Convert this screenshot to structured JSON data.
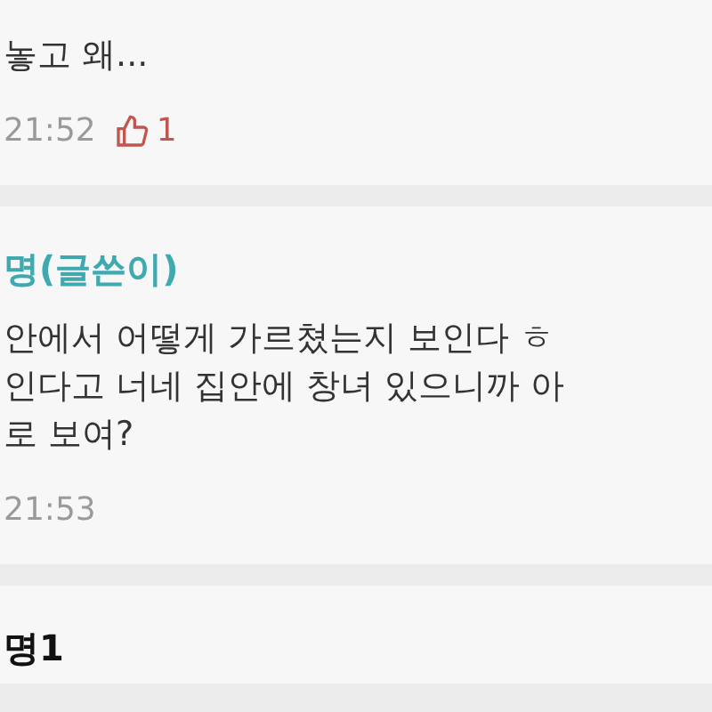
{
  "comments": [
    {
      "body_lines": [
        "놓고 왜..."
      ],
      "time": "21:52",
      "likes": "1"
    },
    {
      "author": "명(글쓴이)",
      "is_writer": true,
      "body_lines": [
        "안에서 어떻게 가르쳤는지 보인다 ㅎ",
        "인다고 너네 집안에 창녀 있으니까 아",
        "로 보여?"
      ],
      "time": "21:53"
    },
    {
      "author": "명1",
      "is_writer": false
    }
  ]
}
